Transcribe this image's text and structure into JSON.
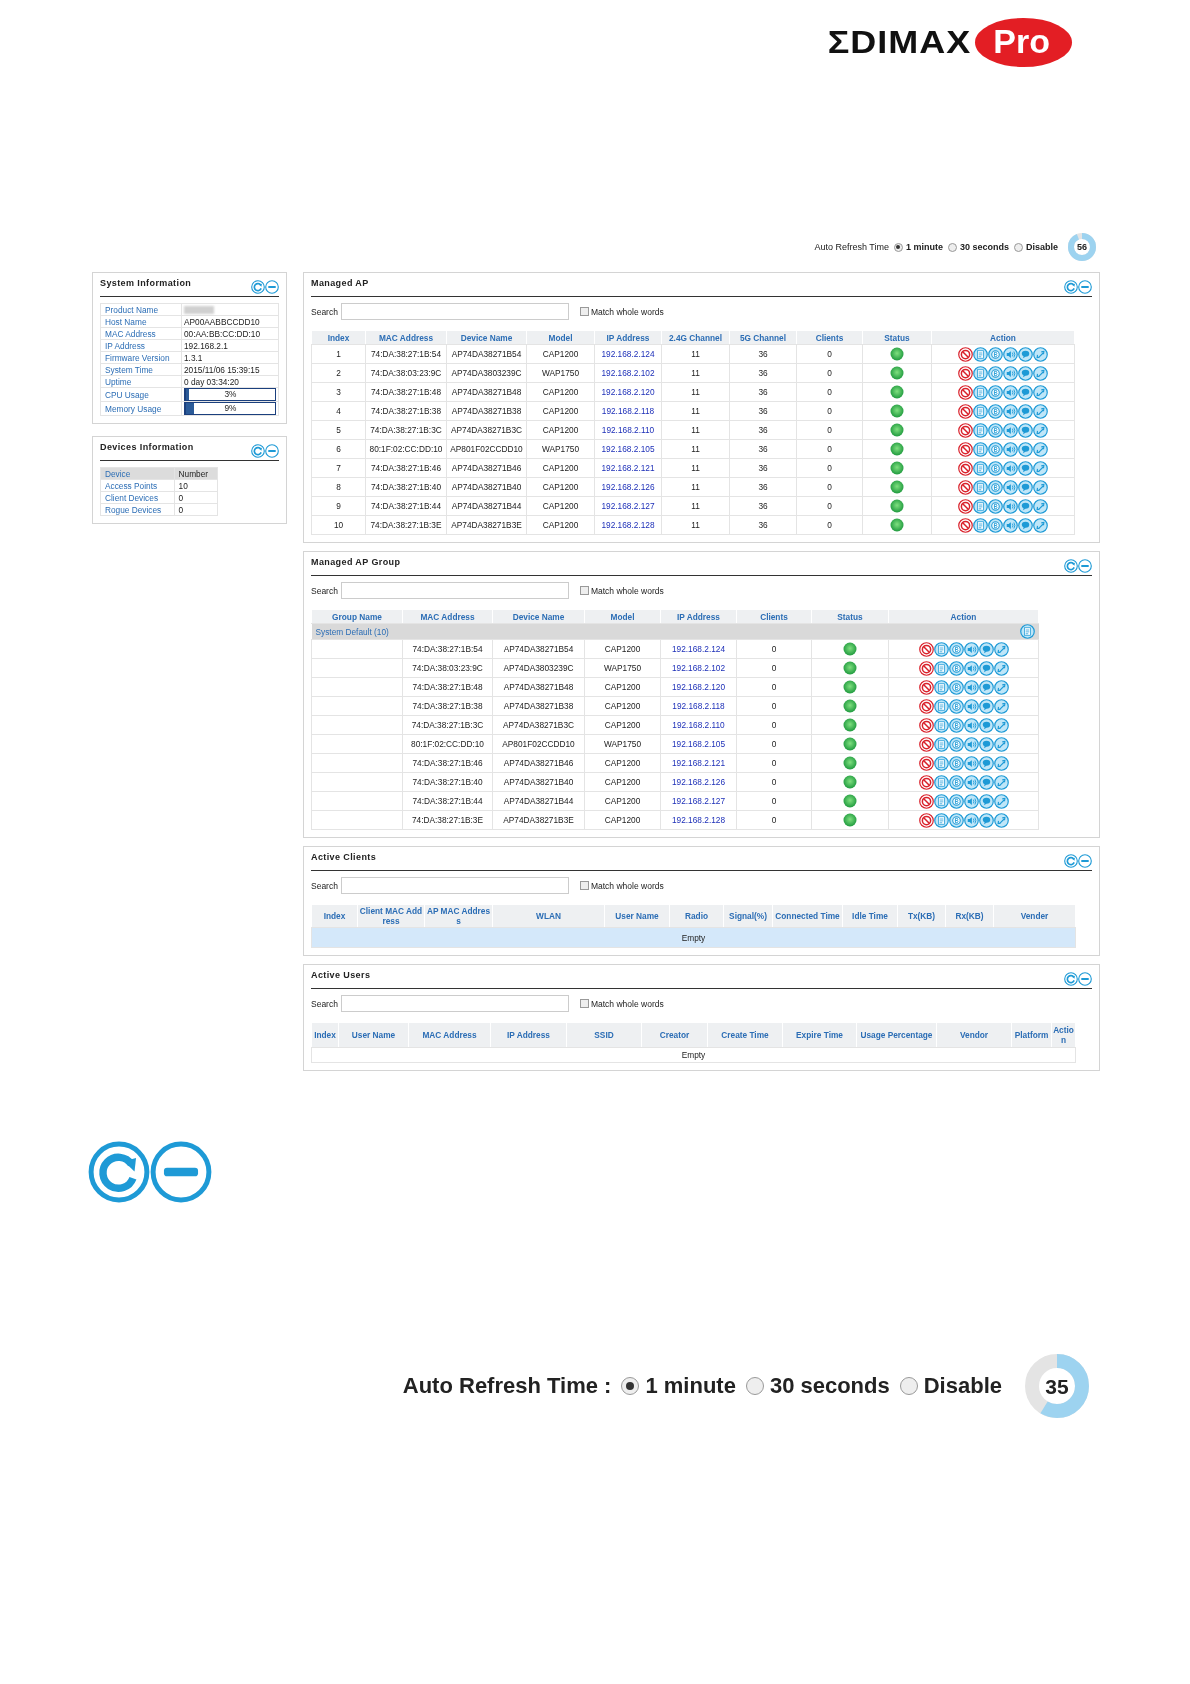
{
  "logo": {
    "wordmark": "ΣDIMAX",
    "badge": "Pro"
  },
  "auto_refresh": {
    "label": "Auto Refresh Time",
    "options": [
      {
        "label": "1 minute",
        "selected": true
      },
      {
        "label": "30 seconds",
        "selected": false
      },
      {
        "label": "Disable",
        "selected": false
      }
    ],
    "countdown": "56"
  },
  "system_information": {
    "title": "System Information",
    "rows": [
      {
        "kind": "redacted",
        "label": "Product Name"
      },
      {
        "kind": "text",
        "label": "Host Name",
        "value": "AP00AABBCCDD10"
      },
      {
        "kind": "text",
        "label": "MAC Address",
        "value": "00:AA:BB:CC:DD:10"
      },
      {
        "kind": "text",
        "label": "IP Address",
        "value": "192.168.2.1"
      },
      {
        "kind": "text",
        "label": "Firmware Version",
        "value": "1.3.1"
      },
      {
        "kind": "text",
        "label": "System Time",
        "value": "2015/11/06 15:39:15"
      },
      {
        "kind": "text",
        "label": "Uptime",
        "value": "0 day 03:34:20"
      },
      {
        "kind": "meter",
        "label": "CPU Usage",
        "value": "3%",
        "level": 0.03
      },
      {
        "kind": "meter",
        "label": "Memory Usage",
        "value": "9%",
        "level": 0.09
      }
    ]
  },
  "devices_information": {
    "title": "Devices Information",
    "columns": [
      "Device",
      "Number"
    ],
    "rows": [
      {
        "device": "Access Points",
        "number": "10"
      },
      {
        "device": "Client Devices",
        "number": "0"
      },
      {
        "device": "Rogue Devices",
        "number": "0"
      }
    ]
  },
  "managed_ap": {
    "title": "Managed AP",
    "search": {
      "label": "Search",
      "match_label": "Match whole words",
      "checked": false
    },
    "columns": [
      "Index",
      "MAC Address",
      "Device Name",
      "Model",
      "IP Address",
      "2.4G Channel",
      "5G Channel",
      "Clients",
      "Status",
      "Action"
    ],
    "rows": [
      {
        "index": "1",
        "mac": "74:DA:38:27:1B:54",
        "device": "AP74DA38271B54",
        "model": "CAP1200",
        "ip": "192.168.2.124",
        "ch24": "11",
        "ch5": "36",
        "clients": "0",
        "online": true
      },
      {
        "index": "2",
        "mac": "74:DA:38:03:23:9C",
        "device": "AP74DA3803239C",
        "model": "WAP1750",
        "ip": "192.168.2.102",
        "ch24": "11",
        "ch5": "36",
        "clients": "0",
        "online": true
      },
      {
        "index": "3",
        "mac": "74:DA:38:27:1B:48",
        "device": "AP74DA38271B48",
        "model": "CAP1200",
        "ip": "192.168.2.120",
        "ch24": "11",
        "ch5": "36",
        "clients": "0",
        "online": true
      },
      {
        "index": "4",
        "mac": "74:DA:38:27:1B:38",
        "device": "AP74DA38271B38",
        "model": "CAP1200",
        "ip": "192.168.2.118",
        "ch24": "11",
        "ch5": "36",
        "clients": "0",
        "online": true
      },
      {
        "index": "5",
        "mac": "74:DA:38:27:1B:3C",
        "device": "AP74DA38271B3C",
        "model": "CAP1200",
        "ip": "192.168.2.110",
        "ch24": "11",
        "ch5": "36",
        "clients": "0",
        "online": true
      },
      {
        "index": "6",
        "mac": "80:1F:02:CC:DD:10",
        "device": "AP801F02CCDD10",
        "model": "WAP1750",
        "ip": "192.168.2.105",
        "ch24": "11",
        "ch5": "36",
        "clients": "0",
        "online": true
      },
      {
        "index": "7",
        "mac": "74:DA:38:27:1B:46",
        "device": "AP74DA38271B46",
        "model": "CAP1200",
        "ip": "192.168.2.121",
        "ch24": "11",
        "ch5": "36",
        "clients": "0",
        "online": true
      },
      {
        "index": "8",
        "mac": "74:DA:38:27:1B:40",
        "device": "AP74DA38271B40",
        "model": "CAP1200",
        "ip": "192.168.2.126",
        "ch24": "11",
        "ch5": "36",
        "clients": "0",
        "online": true
      },
      {
        "index": "9",
        "mac": "74:DA:38:27:1B:44",
        "device": "AP74DA38271B44",
        "model": "CAP1200",
        "ip": "192.168.2.127",
        "ch24": "11",
        "ch5": "36",
        "clients": "0",
        "online": true
      },
      {
        "index": "10",
        "mac": "74:DA:38:27:1B:3E",
        "device": "AP74DA38271B3E",
        "model": "CAP1200",
        "ip": "192.168.2.128",
        "ch24": "11",
        "ch5": "36",
        "clients": "0",
        "online": true
      }
    ]
  },
  "managed_ap_group": {
    "title": "Managed AP Group",
    "search": {
      "label": "Search",
      "match_label": "Match whole words",
      "checked": false
    },
    "columns": [
      "Group Name",
      "MAC Address",
      "Device Name",
      "Model",
      "IP Address",
      "Clients",
      "Status",
      "Action"
    ],
    "groups": [
      {
        "name": "System Default (10)",
        "rows": [
          {
            "mac": "74:DA:38:27:1B:54",
            "device": "AP74DA38271B54",
            "model": "CAP1200",
            "ip": "192.168.2.124",
            "clients": "0",
            "online": true
          },
          {
            "mac": "74:DA:38:03:23:9C",
            "device": "AP74DA3803239C",
            "model": "WAP1750",
            "ip": "192.168.2.102",
            "clients": "0",
            "online": true
          },
          {
            "mac": "74:DA:38:27:1B:48",
            "device": "AP74DA38271B48",
            "model": "CAP1200",
            "ip": "192.168.2.120",
            "clients": "0",
            "online": true
          },
          {
            "mac": "74:DA:38:27:1B:38",
            "device": "AP74DA38271B38",
            "model": "CAP1200",
            "ip": "192.168.2.118",
            "clients": "0",
            "online": true
          },
          {
            "mac": "74:DA:38:27:1B:3C",
            "device": "AP74DA38271B3C",
            "model": "CAP1200",
            "ip": "192.168.2.110",
            "clients": "0",
            "online": true
          },
          {
            "mac": "80:1F:02:CC:DD:10",
            "device": "AP801F02CCDD10",
            "model": "WAP1750",
            "ip": "192.168.2.105",
            "clients": "0",
            "online": true
          },
          {
            "mac": "74:DA:38:27:1B:46",
            "device": "AP74DA38271B46",
            "model": "CAP1200",
            "ip": "192.168.2.121",
            "clients": "0",
            "online": true
          },
          {
            "mac": "74:DA:38:27:1B:40",
            "device": "AP74DA38271B40",
            "model": "CAP1200",
            "ip": "192.168.2.126",
            "clients": "0",
            "online": true
          },
          {
            "mac": "74:DA:38:27:1B:44",
            "device": "AP74DA38271B44",
            "model": "CAP1200",
            "ip": "192.168.2.127",
            "clients": "0",
            "online": true
          },
          {
            "mac": "74:DA:38:27:1B:3E",
            "device": "AP74DA38271B3E",
            "model": "CAP1200",
            "ip": "192.168.2.128",
            "clients": "0",
            "online": true
          }
        ]
      }
    ]
  },
  "active_clients": {
    "title": "Active Clients",
    "search": {
      "label": "Search",
      "match_label": "Match whole words",
      "checked": false
    },
    "columns": [
      "Index",
      "Client MAC Address",
      "AP MAC Address",
      "WLAN",
      "User Name",
      "Radio",
      "Signal(%)",
      "Connected Time",
      "Idle Time",
      "Tx(KB)",
      "Rx(KB)",
      "Vender"
    ],
    "empty": "Empty"
  },
  "active_users": {
    "title": "Active Users",
    "search": {
      "label": "Search",
      "match_label": "Match whole words",
      "checked": false
    },
    "columns": [
      "Index",
      "User Name",
      "MAC Address",
      "IP Address",
      "SSID",
      "Creator",
      "Create Time",
      "Expire Time",
      "Usage Percentage",
      "Vendor",
      "Platform",
      "Action"
    ],
    "empty": "Empty"
  },
  "auto_refresh_detail": {
    "label": "Auto Refresh Time :",
    "options": [
      {
        "label": "1 minute",
        "selected": true
      },
      {
        "label": "30 seconds",
        "selected": false
      },
      {
        "label": "Disable",
        "selected": false
      }
    ],
    "countdown": "35"
  }
}
